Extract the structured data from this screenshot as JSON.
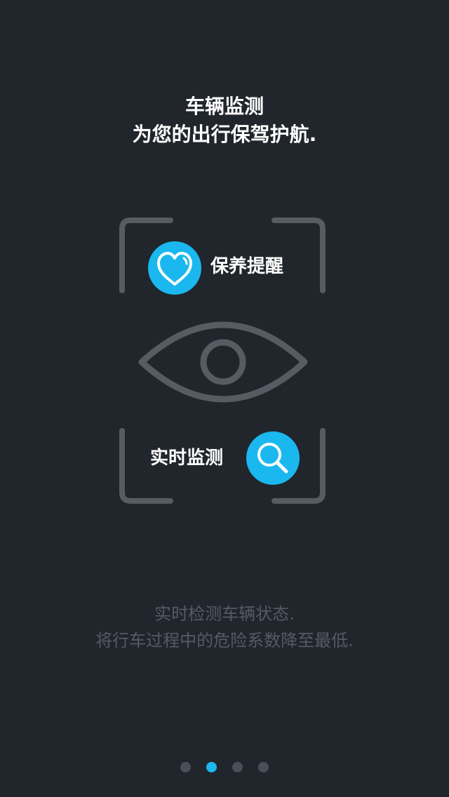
{
  "header": {
    "title": "车辆监测",
    "subtitle": "为您的出行保驾护航."
  },
  "features": {
    "maintenance_label": "保养提醒",
    "monitor_label": "实时监测"
  },
  "description": {
    "line1": "实时检测车辆状态.",
    "line2": "将行车过程中的危险系数降至最低."
  },
  "pager": {
    "count": 4,
    "active_index": 1
  },
  "icons": {
    "maintenance": "heart-icon",
    "monitor": "magnifier-icon",
    "center": "eye-icon"
  },
  "colors": {
    "background": "#21252c",
    "accent": "#1ab8ef",
    "frame": "#575b62",
    "description_text": "#565b63",
    "dot_inactive": "#4a4e56"
  }
}
